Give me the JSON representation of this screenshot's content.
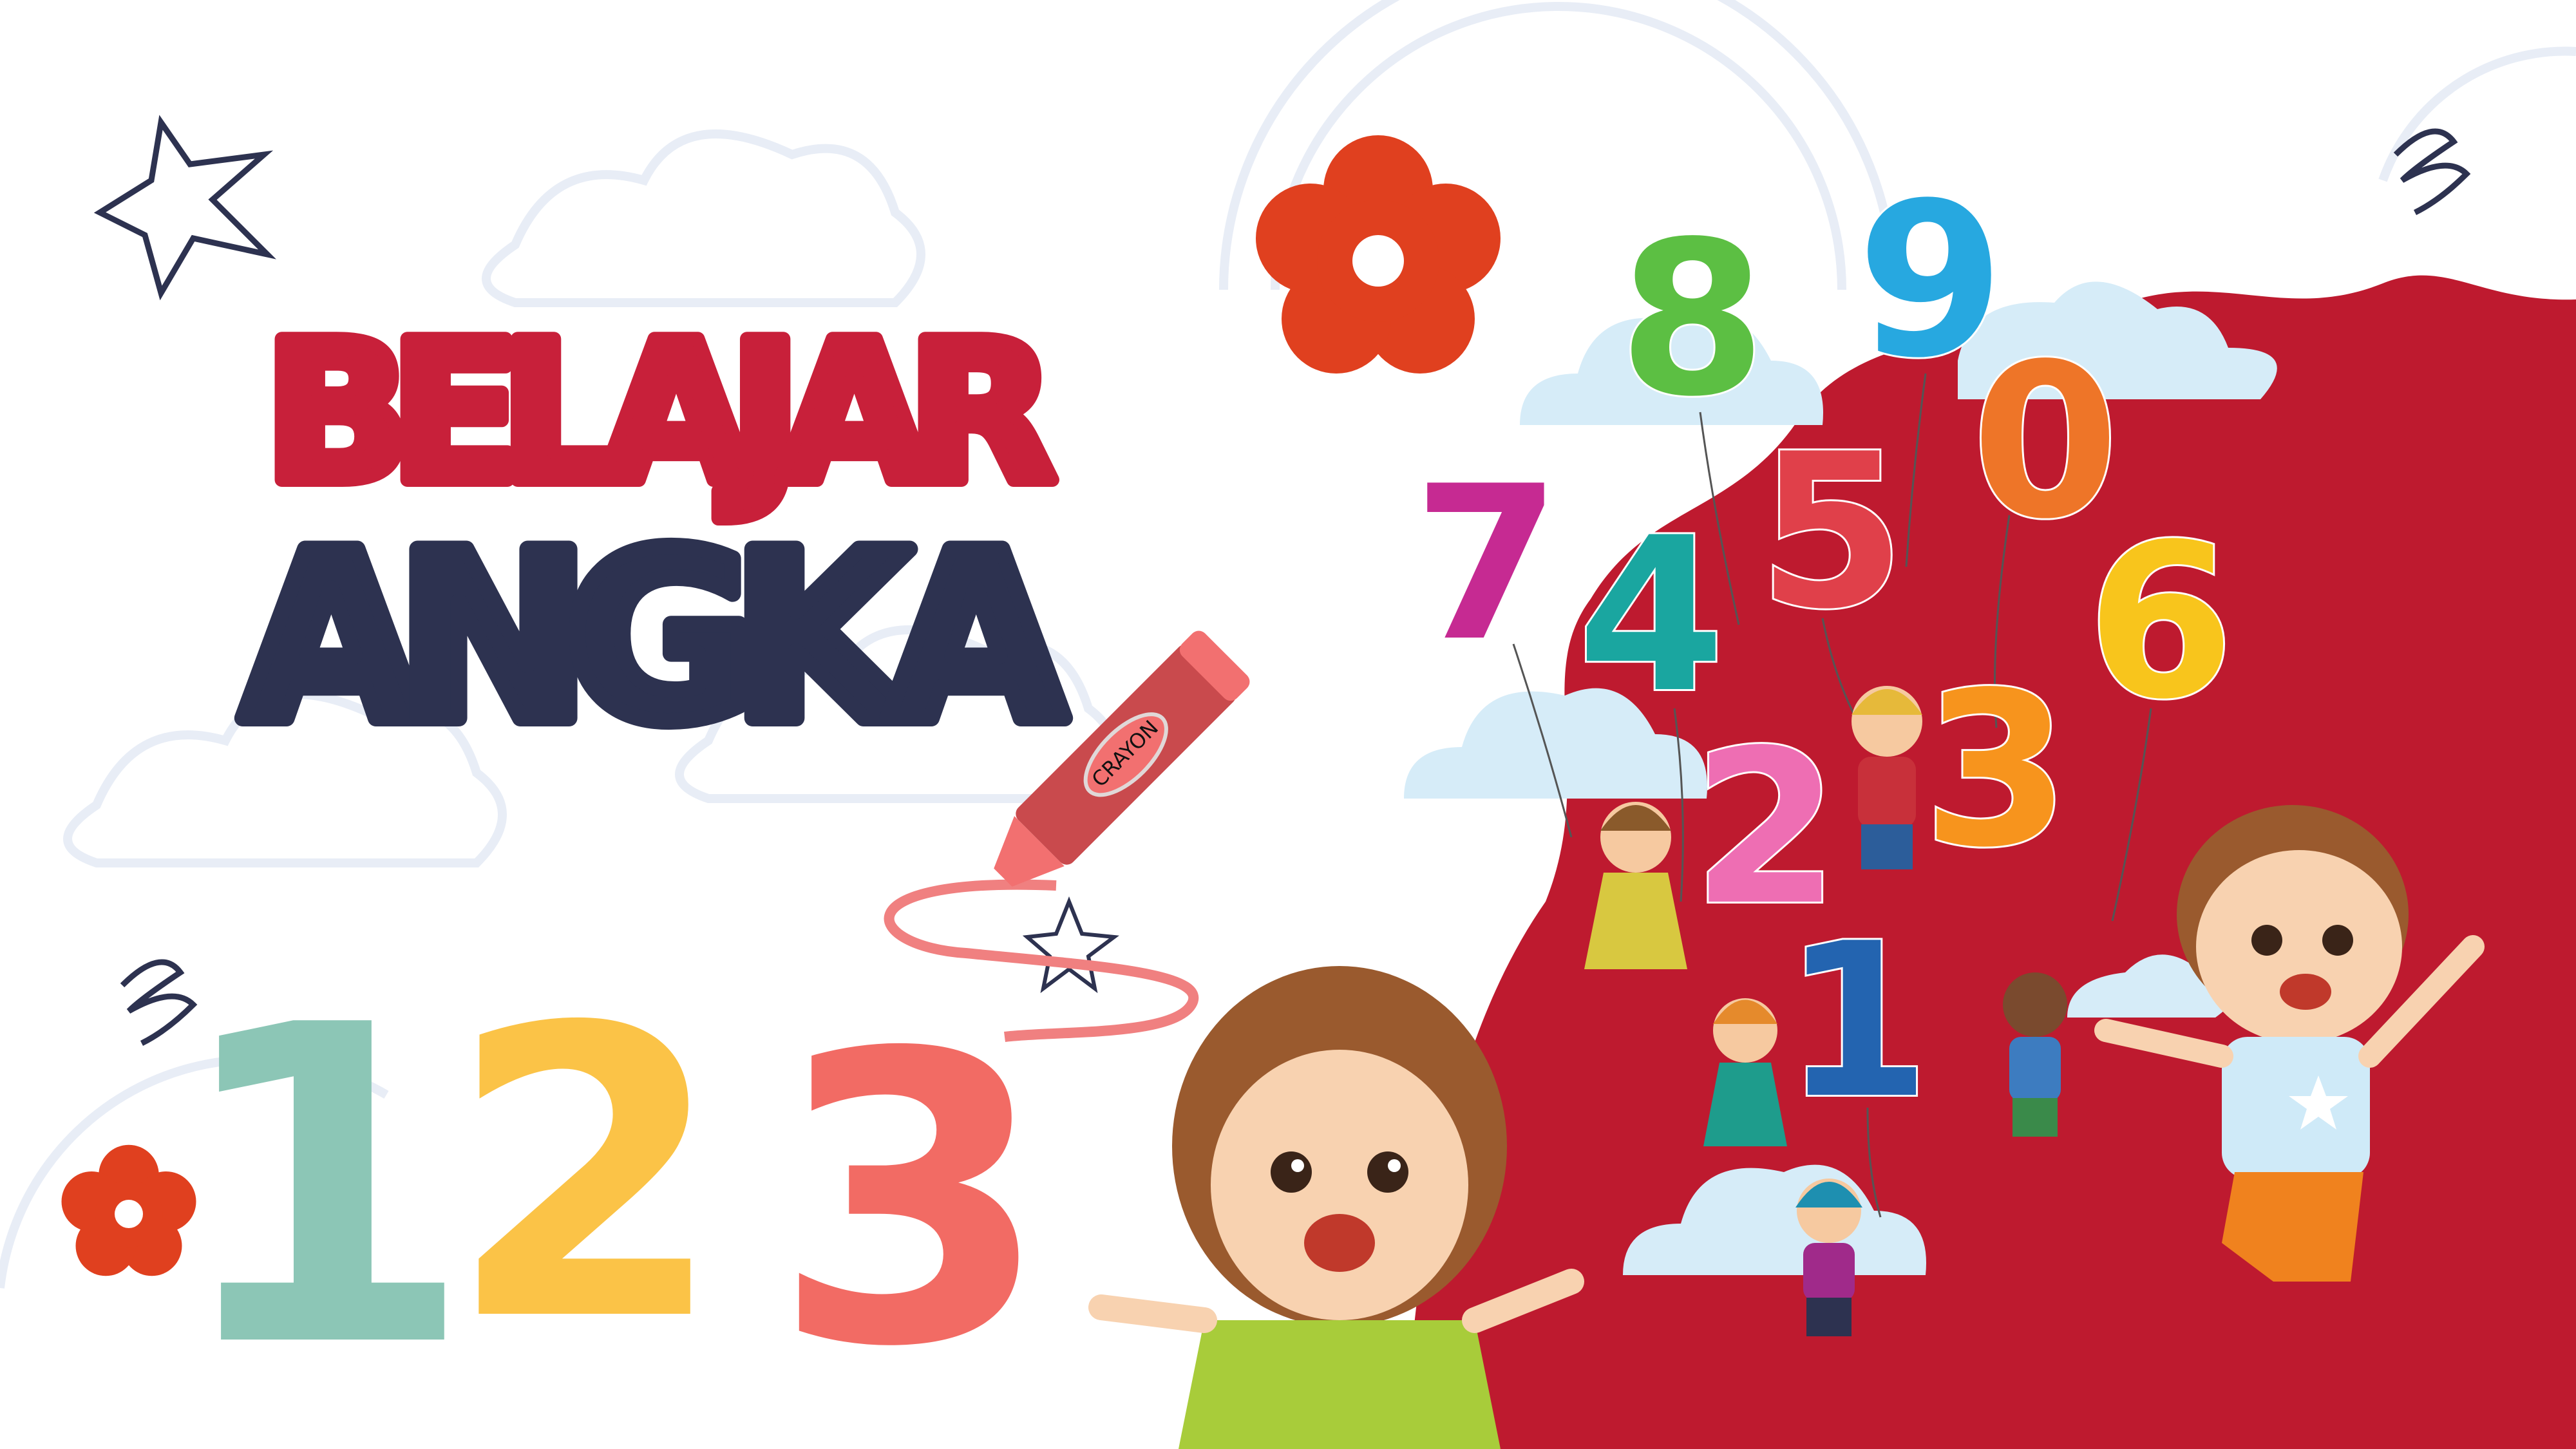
{
  "title": {
    "line1": "BELAJAR",
    "line2": "ANGKA"
  },
  "crayon_label": "CRAYON",
  "big_numbers": [
    "1",
    "2",
    "3"
  ],
  "balloons": [
    "8",
    "9",
    "7",
    "4",
    "5",
    "0",
    "6",
    "2",
    "3",
    "1"
  ],
  "colors": {
    "title_red": "#c8203a",
    "title_navy": "#2d3250",
    "blob_red": "#be1a2f",
    "flower_red": "#e0401f",
    "num1": "#8cc6b6",
    "num2": "#fbc347",
    "num3": "#f26b64"
  }
}
